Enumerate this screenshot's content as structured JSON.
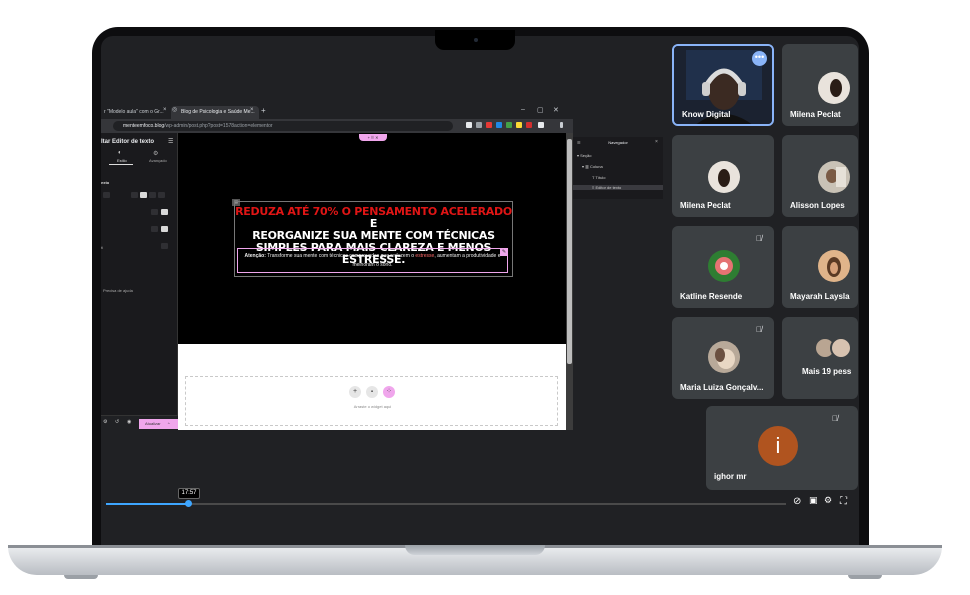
{
  "browser": {
    "tabs": [
      {
        "label": "r \"Modelo aula\" com o Gr..."
      },
      {
        "label": "Blog de Psicologia e Saúde Me..."
      }
    ],
    "new_tab": "+",
    "window_controls": [
      "–",
      "▢",
      "✕"
    ],
    "url_host": "menteemfoco.blog",
    "url_path": "/wp-admin/post.php?post=1578action=elementor"
  },
  "editor": {
    "panel_title": "Itar Editor de texto",
    "tab_style": "Estilo",
    "tab_advanced": "Avançado",
    "section_label": "exto",
    "help_label": "Precisa de ajuda",
    "publish_label": "Atualizar",
    "collapse_arrow": "‹"
  },
  "hero": {
    "tag": "+ ⠿ ✕",
    "headline_red": "REDUZA ATÉ 70% O PENSAMENTO ACELERADO",
    "headline_e": " E",
    "headline_rest": "REORGANIZE SUA MENTE COM TÉCNICAS SIMPLES PARA MAIS CLAREZA E MENOS ESTRESSE.",
    "attention_label": "Atenção:",
    "subtext_1": " Transforme sua mente com técnicas comprovadas que reduzem o ",
    "subtext_red": "estresse",
    "subtext_2": ", aumentam a produtividade e melhoram o sono."
  },
  "drop_zone": {
    "label": "Arraste o widget aqui",
    "add": "+",
    "folder": "▪",
    "ai": "⁘"
  },
  "navigator": {
    "title": "Navegador",
    "items": [
      "Seção",
      "Coluna",
      "Título",
      "Editor de texto"
    ]
  },
  "participants": [
    {
      "name": "Know Digital",
      "active_speaker": true
    },
    {
      "name": "Milena Peclat"
    },
    {
      "name": "Milena Peclat"
    },
    {
      "name": "Alisson Lopes"
    },
    {
      "name": "Katline Resende",
      "muted": true
    },
    {
      "name": "Mayarah Laysla",
      "muted": true
    },
    {
      "name": "Maria Luiza Gonçalv...",
      "muted": true
    },
    {
      "name": "Mais 19 pess"
    },
    {
      "name": "ighor mr",
      "initial": "i",
      "muted": true
    }
  ],
  "player": {
    "timestamp": "17:57",
    "progress": 0.12,
    "icons": [
      "no-autoplay-icon",
      "subtitles-icon",
      "settings-icon",
      "fullscreen-icon"
    ]
  },
  "colors": {
    "accent_pink": "#f0a6ec",
    "headline_red": "#e01515",
    "progress_blue": "#3ea6ff",
    "tile_bg": "#3c4043",
    "speaker_border": "#8ab4f8",
    "avatar_orange": "#b0541f"
  }
}
